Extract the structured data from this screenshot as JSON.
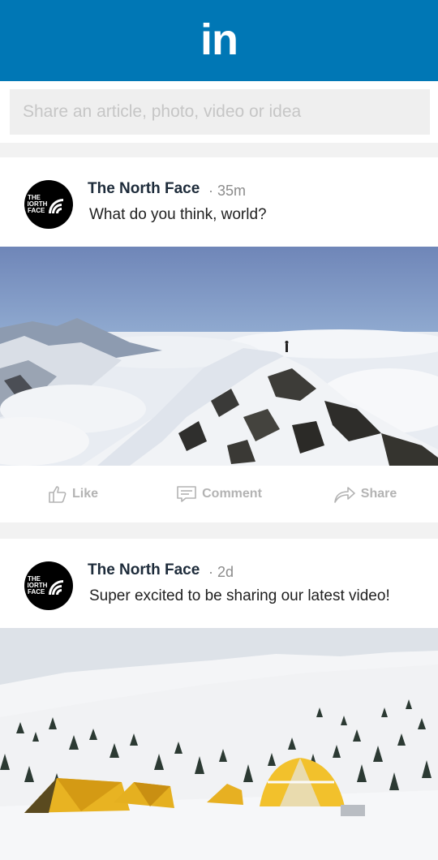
{
  "header": {
    "logo_text": "in"
  },
  "composer": {
    "placeholder": "Share an article, photo, video or idea"
  },
  "posts": [
    {
      "author": "The North Face",
      "time": "· 35m",
      "message": "What do you think, world?",
      "avatar_text": [
        "THE",
        "NORTH",
        "FACE"
      ],
      "photo_description": "snowy mountain summit with climber above clouds"
    },
    {
      "author": "The North Face",
      "time": "· 2d",
      "message": "Super excited to be sharing our latest video!",
      "avatar_text": [
        "THE",
        "NORTH",
        "FACE"
      ],
      "photo_description": "yellow tents on snowy mountainside with pine trees"
    }
  ],
  "actions": {
    "like": "Like",
    "comment": "Comment",
    "share": "Share"
  },
  "colors": {
    "brand": "#0077b5",
    "icon_gray": "#b3b3b3"
  },
  "icons": [
    "thumbs-up-icon",
    "comment-icon",
    "share-arrow-icon"
  ]
}
